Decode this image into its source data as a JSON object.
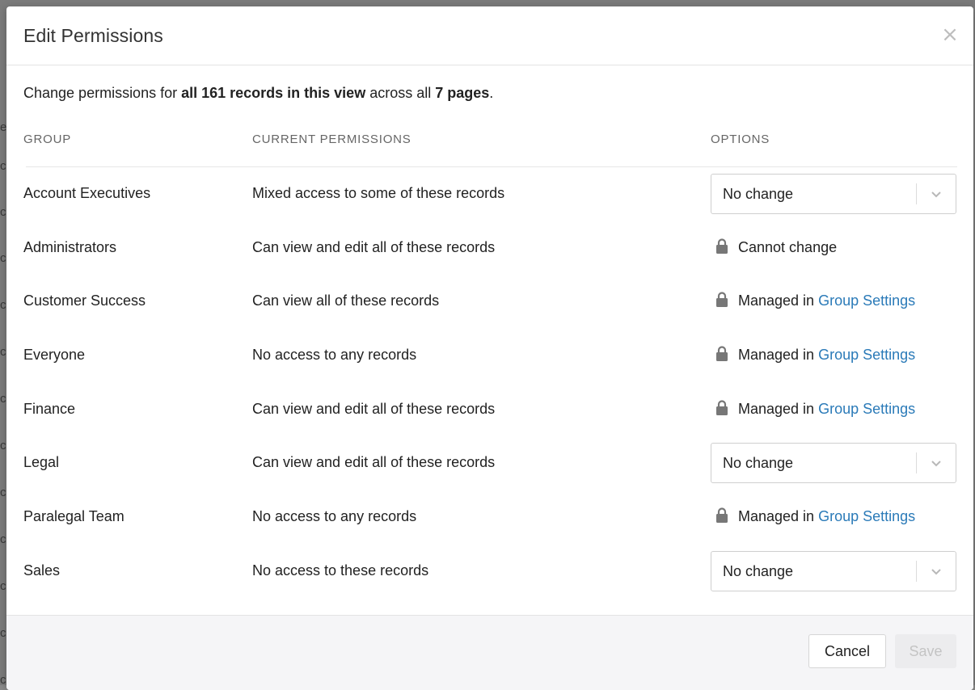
{
  "background": {
    "row_glyphs": [
      "e",
      "c",
      "c",
      "c",
      "c",
      "c",
      "c",
      "c",
      "c",
      "c",
      "c",
      "c",
      "c"
    ]
  },
  "modal": {
    "title": "Edit Permissions",
    "close_label": "×",
    "summary": {
      "prefix": "Change permissions for ",
      "bold_records": "all 161 records in this view",
      "middle": " across all ",
      "bold_pages": "7 pages",
      "suffix": "."
    },
    "columns": {
      "group": "GROUP",
      "current": "CURRENT PERMISSIONS",
      "options": "OPTIONS"
    },
    "rows": [
      {
        "group": "Account Executives",
        "current": "Mixed access to some of these records",
        "option_type": "select",
        "option_value": "No change"
      },
      {
        "group": "Administrators",
        "current": "Can view and edit all of these records",
        "option_type": "locked",
        "option_text": "Cannot change"
      },
      {
        "group": "Customer Success",
        "current": "Can view all of these records",
        "option_type": "managed",
        "option_text": "Managed in ",
        "link_text": "Group Settings"
      },
      {
        "group": "Everyone",
        "current": "No access to any records",
        "option_type": "managed",
        "option_text": "Managed in ",
        "link_text": "Group Settings"
      },
      {
        "group": "Finance",
        "current": "Can view and edit all of these records",
        "option_type": "managed",
        "option_text": "Managed in ",
        "link_text": "Group Settings"
      },
      {
        "group": "Legal",
        "current": "Can view and edit all of these records",
        "option_type": "select",
        "option_value": "No change"
      },
      {
        "group": "Paralegal Team",
        "current": "No access to any records",
        "option_type": "managed",
        "option_text": "Managed in ",
        "link_text": "Group Settings"
      },
      {
        "group": "Sales",
        "current": "No access to these records",
        "option_type": "select",
        "option_value": "No change"
      }
    ],
    "footer": {
      "cancel_label": "Cancel",
      "save_label": "Save"
    }
  },
  "colors": {
    "link": "#2a7ab8",
    "text": "#222222",
    "muted": "#666666",
    "disabled": "#c4c4c4"
  },
  "icons": {
    "close": "close-icon",
    "lock": "lock-icon",
    "chevron": "chevron-down-icon"
  }
}
